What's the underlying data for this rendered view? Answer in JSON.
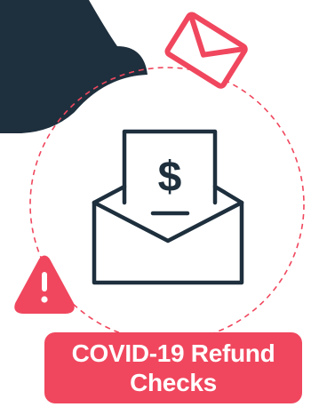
{
  "banner": {
    "title": "COVID-19 Refund Checks"
  },
  "icons": {
    "background_shape": "dark-blob-shape",
    "top_mail": "envelope-icon",
    "center": "envelope-with-check-icon",
    "check_symbol": "dollar-sign",
    "warning": "warning-triangle-icon"
  },
  "colors": {
    "dark": "#1e2f3d",
    "accent": "#f0475e",
    "outline": "#1e2f3d",
    "background": "#ffffff"
  }
}
